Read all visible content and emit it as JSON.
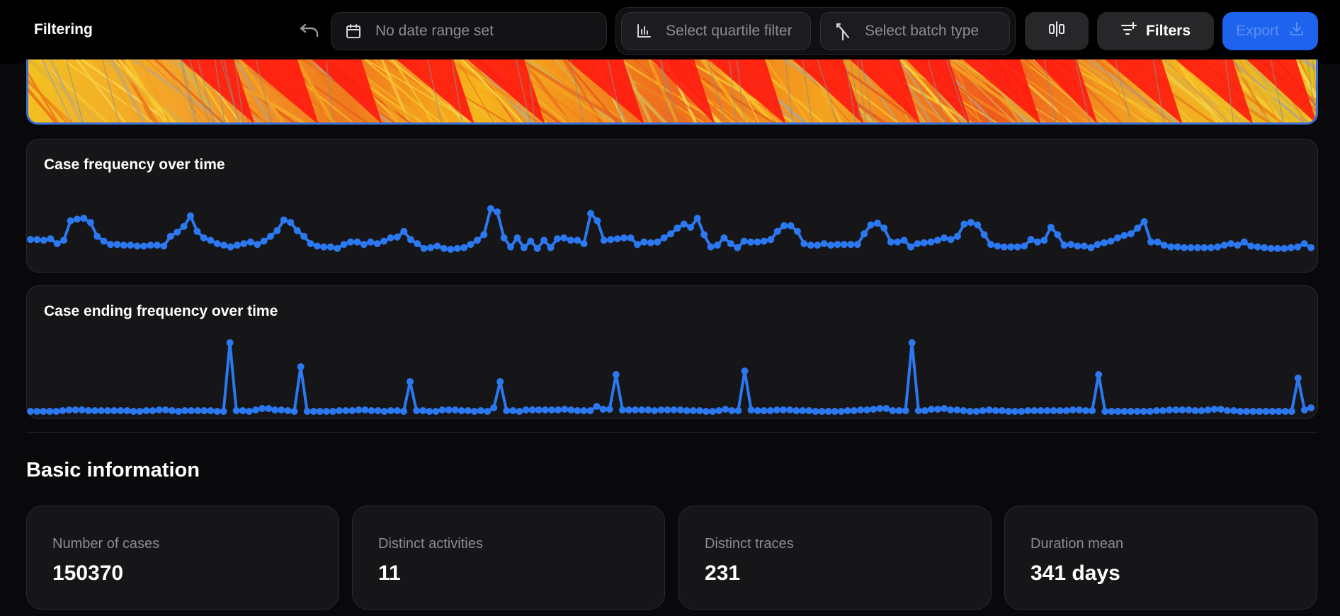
{
  "header": {
    "title": "Filtering",
    "date_placeholder": "No date range set",
    "quartile_placeholder": "Select quartile filter",
    "batch_placeholder": "Select batch type",
    "filters_label": "Filters",
    "export_label": "Export"
  },
  "icons": {
    "undo": "undo-icon",
    "calendar": "calendar-icon",
    "quartile": "bar-chart-icon",
    "batch": "merge-icon",
    "compare": "compare-icon",
    "filters": "filter-add-icon",
    "export": "download-icon"
  },
  "colors": {
    "accent": "#2b78f0",
    "export": "#1d63ed",
    "strip_red": "#ff1a10",
    "strip_yellow": "#f2c021"
  },
  "charts": {
    "frequency_title": "Case frequency over time",
    "ending_title": "Case ending frequency over time"
  },
  "chart_data": [
    {
      "type": "line",
      "title": "Case frequency over time",
      "values": [
        38,
        38,
        37,
        39,
        33,
        37,
        61,
        63,
        64,
        59,
        42,
        36,
        32,
        32,
        31,
        31,
        30,
        30,
        31,
        31,
        30,
        42,
        47,
        54,
        67,
        48,
        40,
        37,
        33,
        31,
        29,
        31,
        33,
        35,
        32,
        36,
        42,
        49,
        62,
        59,
        49,
        42,
        33,
        30,
        29,
        29,
        27,
        32,
        35,
        35,
        32,
        35,
        33,
        36,
        40,
        41,
        48,
        38,
        33,
        27,
        28,
        30,
        27,
        26,
        27,
        28,
        32,
        37,
        44,
        76,
        72,
        40,
        29,
        40,
        28,
        36,
        27,
        37,
        28,
        39,
        40,
        37,
        37,
        33,
        70,
        61,
        37,
        38,
        39,
        40,
        40,
        32,
        35,
        34,
        35,
        40,
        45,
        52,
        57,
        53,
        64,
        44,
        29,
        31,
        40,
        33,
        28,
        36,
        35,
        35,
        36,
        38,
        48,
        55,
        55,
        48,
        33,
        31,
        31,
        33,
        31,
        32,
        32,
        32,
        32,
        45,
        56,
        58,
        52,
        35,
        35,
        37,
        29,
        33,
        34,
        35,
        37,
        40,
        38,
        42,
        57,
        59,
        56,
        44,
        32,
        30,
        29,
        29,
        29,
        30,
        38,
        35,
        37,
        53,
        44,
        31,
        32,
        30,
        30,
        28,
        32,
        34,
        36,
        40,
        43,
        45,
        52,
        60,
        35,
        35,
        31,
        29,
        29,
        28,
        28,
        28,
        28,
        28,
        29,
        31,
        33,
        31,
        35,
        30,
        29,
        28,
        27,
        27,
        27,
        28,
        29,
        33,
        28
      ],
      "ylim": [
        0,
        100
      ],
      "grid": false
    },
    {
      "type": "line",
      "title": "Case ending frequency over time",
      "values": [
        3,
        3,
        3,
        3,
        3,
        4,
        5,
        5,
        5,
        4,
        4,
        4,
        4,
        4,
        4,
        4,
        3,
        3,
        4,
        4,
        5,
        5,
        4,
        3,
        4,
        4,
        4,
        4,
        4,
        3,
        3,
        100,
        4,
        4,
        3,
        5,
        7,
        7,
        5,
        5,
        4,
        3,
        66,
        3,
        3,
        3,
        3,
        3,
        4,
        4,
        4,
        5,
        5,
        4,
        4,
        3,
        4,
        4,
        3,
        45,
        4,
        4,
        3,
        3,
        5,
        5,
        5,
        4,
        4,
        3,
        4,
        3,
        8,
        45,
        4,
        4,
        3,
        5,
        5,
        5,
        5,
        5,
        5,
        6,
        5,
        4,
        4,
        4,
        10,
        6,
        6,
        55,
        5,
        5,
        5,
        5,
        5,
        4,
        5,
        5,
        5,
        5,
        4,
        4,
        4,
        3,
        3,
        4,
        6,
        4,
        4,
        60,
        5,
        4,
        4,
        4,
        5,
        5,
        5,
        4,
        4,
        4,
        3,
        3,
        3,
        3,
        3,
        4,
        4,
        5,
        5,
        6,
        7,
        7,
        4,
        4,
        4,
        100,
        4,
        4,
        6,
        6,
        7,
        5,
        5,
        4,
        3,
        3,
        4,
        5,
        4,
        4,
        3,
        3,
        3,
        4,
        4,
        4,
        4,
        4,
        4,
        4,
        5,
        5,
        4,
        4,
        55,
        3,
        3,
        3,
        3,
        3,
        3,
        3,
        3,
        4,
        4,
        5,
        5,
        5,
        5,
        4,
        4,
        5,
        6,
        6,
        4,
        4,
        3,
        3,
        3,
        3,
        3,
        3,
        3,
        3,
        3,
        50,
        5,
        8
      ],
      "ylim": [
        0,
        100
      ],
      "grid": false
    }
  ],
  "basic_info": {
    "title": "Basic information",
    "stats": [
      {
        "label": "Number of cases",
        "value": "150370"
      },
      {
        "label": "Distinct activities",
        "value": "11"
      },
      {
        "label": "Distinct traces",
        "value": "231"
      },
      {
        "label": "Duration mean",
        "value": "341 days"
      }
    ]
  }
}
